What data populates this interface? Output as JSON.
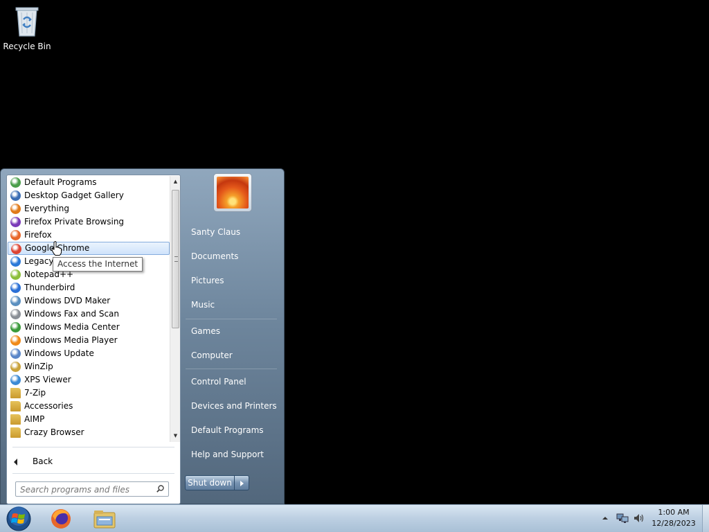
{
  "desktop": {
    "icons": [
      {
        "label": "Recycle Bin",
        "icon": "recycle-bin-icon"
      }
    ]
  },
  "start_menu": {
    "programs": [
      {
        "label": "Default Programs",
        "icon": "default-programs-icon",
        "color": "#4b9e4b"
      },
      {
        "label": "Desktop Gadget Gallery",
        "icon": "gadget-gallery-icon",
        "color": "#3b6db4"
      },
      {
        "label": "Everything",
        "icon": "everything-magnifier-icon",
        "color": "#e07a1a"
      },
      {
        "label": "Firefox Private Browsing",
        "icon": "firefox-private-icon",
        "color": "#7a3ab8"
      },
      {
        "label": "Firefox",
        "icon": "firefox-icon",
        "color": "#e8672a"
      },
      {
        "label": "Google Chrome",
        "icon": "chrome-icon",
        "color": "#dd4433",
        "selected": true
      },
      {
        "label": "Legacy",
        "icon": "legacy-edge-icon",
        "color": "#2b79d8"
      },
      {
        "label": "Notepad++",
        "icon": "notepad-plus-plus-icon",
        "color": "#8bbf3a"
      },
      {
        "label": "Thunderbird",
        "icon": "thunderbird-icon",
        "color": "#2a6fd6"
      },
      {
        "label": "Windows DVD Maker",
        "icon": "dvd-maker-icon",
        "color": "#5a8fc0"
      },
      {
        "label": "Windows Fax and Scan",
        "icon": "fax-scan-icon",
        "color": "#8a8f96"
      },
      {
        "label": "Windows Media Center",
        "icon": "media-center-icon",
        "color": "#3a9a3a"
      },
      {
        "label": "Windows Media Player",
        "icon": "media-player-icon",
        "color": "#f08a1a"
      },
      {
        "label": "Windows Update",
        "icon": "windows-update-icon",
        "color": "#5a86c8"
      },
      {
        "label": "WinZip",
        "icon": "winzip-icon",
        "color": "#c9a23a"
      },
      {
        "label": "XPS Viewer",
        "icon": "xps-viewer-icon",
        "color": "#3c8ad4"
      },
      {
        "label": "7-Zip",
        "icon": "folder-icon",
        "color": "#e6c25a"
      },
      {
        "label": "Accessories",
        "icon": "folder-icon",
        "color": "#e6c25a"
      },
      {
        "label": "AIMP",
        "icon": "folder-icon",
        "color": "#e6c25a"
      },
      {
        "label": "Crazy Browser",
        "icon": "folder-icon",
        "color": "#e6c25a"
      }
    ],
    "back_label": "Back",
    "search_placeholder": "Search programs and files",
    "tooltip": "Access the Internet",
    "right_items": [
      {
        "label": "Santy Claus"
      },
      {
        "label": "Documents"
      },
      {
        "label": "Pictures"
      },
      {
        "label": "Music"
      },
      {
        "label": "Games"
      },
      {
        "label": "Computer"
      },
      {
        "label": "Control Panel"
      },
      {
        "label": "Devices and Printers"
      },
      {
        "label": "Default Programs"
      },
      {
        "label": "Help and Support"
      }
    ],
    "shutdown_label": "Shut down"
  },
  "taskbar": {
    "pinned": [
      {
        "name": "firefox-taskbar-icon"
      },
      {
        "name": "explorer-taskbar-icon"
      }
    ],
    "clock_time": "1:00 AM",
    "clock_date": "12/28/2023"
  }
}
